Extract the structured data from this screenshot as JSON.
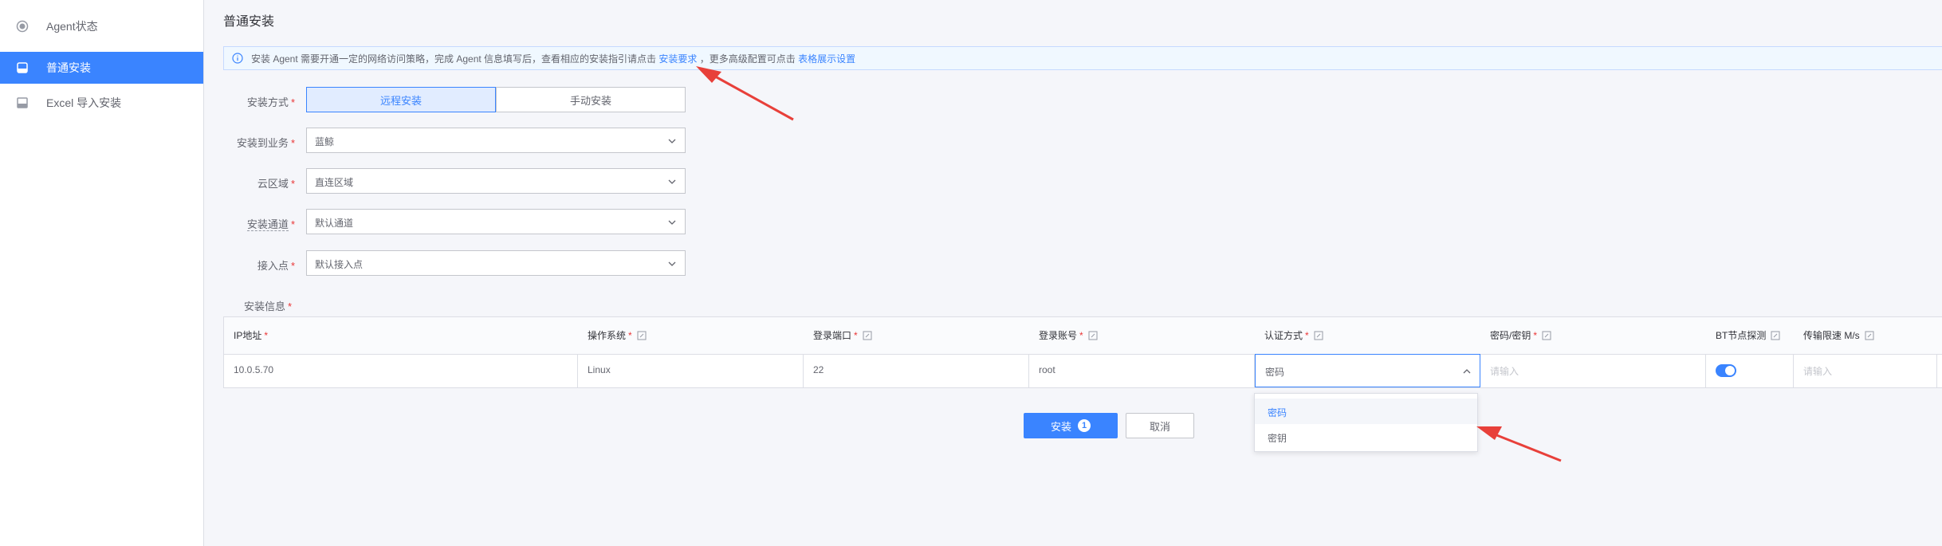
{
  "sidebar": {
    "items": [
      {
        "label": "Agent状态"
      },
      {
        "label": "普通安装"
      },
      {
        "label": "Excel 导入安装"
      }
    ]
  },
  "main": {
    "title": "普通安装",
    "alert": {
      "text_before": "安装 Agent 需要开通一定的网络访问策略，完成 Agent 信息填写后，查看相应的安装指引请点击",
      "link1": "安装要求",
      "text_mid": "，更多高级配置可点击",
      "link2": "表格展示设置"
    },
    "form": {
      "install_method_label": "安装方式",
      "install_method_options": [
        "远程安装",
        "手动安装"
      ],
      "biz_label": "安装到业务",
      "biz_value": "蓝鲸",
      "cloud_label": "云区域",
      "cloud_value": "直连区域",
      "channel_label": "安装通道",
      "channel_value": "默认通道",
      "ap_label": "接入点",
      "ap_value": "默认接入点",
      "info_label": "安装信息"
    },
    "table": {
      "headers": [
        "IP地址",
        "操作系统",
        "登录端口",
        "登录账号",
        "认证方式",
        "密码/密钥",
        "BT节点探测",
        "传输限速 M/s"
      ],
      "row": {
        "ip": "10.0.5.70",
        "os": "Linux",
        "port": "22",
        "account": "root",
        "auth": "密码",
        "password_placeholder": "请输入",
        "speed_placeholder": "请输入"
      }
    },
    "auth_dropdown": [
      "密码",
      "密钥"
    ],
    "buttons": {
      "install": "安装",
      "install_badge": "1",
      "cancel": "取消"
    }
  },
  "colors": {
    "primary": "#3a84ff",
    "required": "#ea3636",
    "annotation_arrow": "#e8403a"
  }
}
